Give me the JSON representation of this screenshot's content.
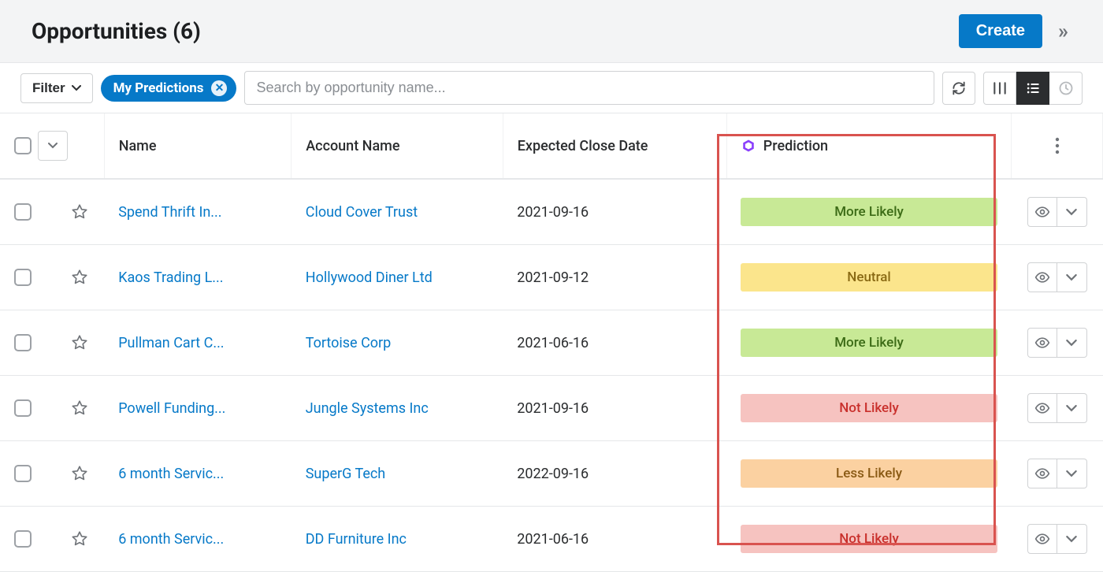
{
  "header": {
    "title": "Opportunities (6)",
    "create_label": "Create"
  },
  "toolbar": {
    "filter_label": "Filter",
    "chip_label": "My Predictions",
    "search_placeholder": "Search by opportunity name..."
  },
  "columns": {
    "name": "Name",
    "account": "Account Name",
    "expected_close": "Expected Close Date",
    "prediction": "Prediction"
  },
  "rows": [
    {
      "name": "Spend Thrift In...",
      "account": "Cloud Cover Trust",
      "date": "2021-09-16",
      "prediction": "More Likely",
      "prediction_class": "badge-more-likely"
    },
    {
      "name": "Kaos Trading L...",
      "account": "Hollywood Diner Ltd",
      "date": "2021-09-12",
      "prediction": "Neutral",
      "prediction_class": "badge-neutral"
    },
    {
      "name": "Pullman Cart C...",
      "account": "Tortoise Corp",
      "date": "2021-06-16",
      "prediction": "More Likely",
      "prediction_class": "badge-more-likely"
    },
    {
      "name": "Powell Funding...",
      "account": "Jungle Systems Inc",
      "date": "2021-09-16",
      "prediction": "Not Likely",
      "prediction_class": "badge-not-likely"
    },
    {
      "name": "6 month Servic...",
      "account": "SuperG Tech",
      "date": "2022-09-16",
      "prediction": "Less Likely",
      "prediction_class": "badge-less-likely"
    },
    {
      "name": "6 month Servic...",
      "account": "DD Furniture Inc",
      "date": "2021-06-16",
      "prediction": "Not Likely",
      "prediction_class": "badge-not-likely"
    }
  ]
}
